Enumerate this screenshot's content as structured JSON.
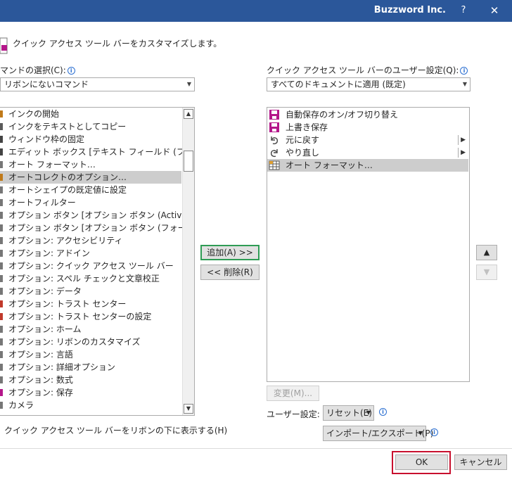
{
  "window": {
    "app_name": "Buzzword Inc.",
    "help_label": "?",
    "close_label": "✕"
  },
  "header": {
    "title": "クイック アクセス ツール バーをカスタマイズします。"
  },
  "left": {
    "command_label": "マンドの選択(C):",
    "command_value": "リボンにないコマンド",
    "items": [
      "インクの開始",
      "インクをテキストとしてコピー",
      "ウィンドウ枠の固定",
      "エディット ボックス [テキスト フィールド (フォー…",
      "オート フォーマット…",
      "オートコレクトのオプション…",
      "オートシェイプの既定値に設定",
      "オートフィルター",
      "オプション ボタン [オプション ボタン (Active…",
      "オプション ボタン [オプション ボタン (フォーム …",
      "オプション: アクセシビリティ",
      "オプション: アドイン",
      "オプション: クイック アクセス ツール バー",
      "オプション: スペル チェックと文章校正",
      "オプション: データ",
      "オプション: トラスト センター",
      "オプション: トラスト センターの設定",
      "オプション: ホーム",
      "オプション: リボンのカスタマイズ",
      "オプション: 言語",
      "オプション: 詳細オプション",
      "オプション: 数式",
      "オプション: 保存",
      "カメラ"
    ],
    "show_below_label": "クイック アクセス ツール バーをリボンの下に表示する(H)"
  },
  "middle": {
    "add_label": "追加(A) >>",
    "remove_label": "<< 削除(R)"
  },
  "right": {
    "settings_label": "クイック アクセス ツール バーのユーザー設定(Q):",
    "settings_value": "すべてのドキュメントに適用 (既定)",
    "items": [
      {
        "label": "自動保存のオン/オフ切り替え",
        "icon": "save-icon"
      },
      {
        "label": "上書き保存",
        "icon": "save-icon"
      },
      {
        "label": "元に戻す",
        "icon": "undo-icon"
      },
      {
        "label": "やり直し",
        "icon": "redo-icon"
      },
      {
        "label": "オート フォーマット…",
        "icon": "table-format-icon"
      }
    ],
    "modify_label": "変更(M)...",
    "user_settings_label": "ユーザー設定:",
    "reset_label": "リセット(E)",
    "import_export_label": "インポート/エクスポート(P)"
  },
  "footer": {
    "ok_label": "OK",
    "cancel_label": "キャンセル"
  },
  "colors": {
    "titlebar": "#2b579a",
    "selection": "#cdcdcd",
    "focus_border": "#2f9c55",
    "ok_highlight": "#c8102e"
  }
}
